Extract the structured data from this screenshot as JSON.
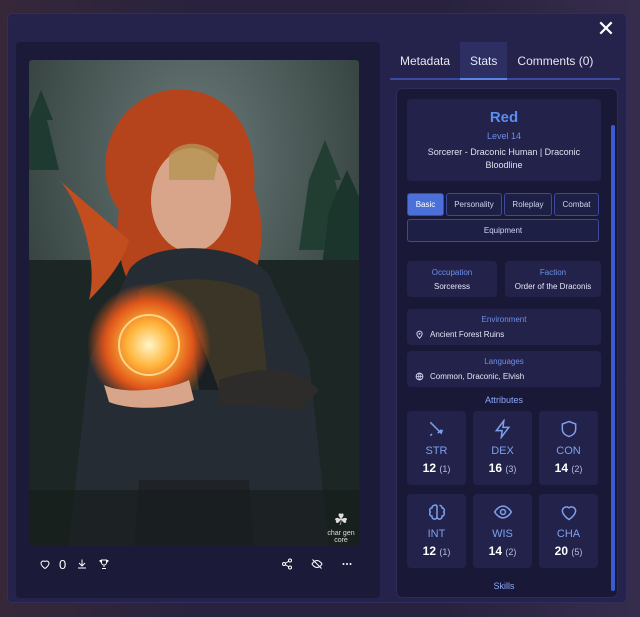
{
  "header": {
    "close_label": "✕"
  },
  "tabs": [
    {
      "label": "Metadata"
    },
    {
      "label": "Stats"
    },
    {
      "label": "Comments (0)"
    }
  ],
  "character": {
    "name": "Red",
    "level": "Level 14",
    "class_line": "Sorcerer - Draconic Human | Draconic Bloodline"
  },
  "subtabs": [
    {
      "label": "Basic"
    },
    {
      "label": "Personality"
    },
    {
      "label": "Roleplay"
    },
    {
      "label": "Combat"
    },
    {
      "label": "Equipment"
    }
  ],
  "info": {
    "occupation_label": "Occupation",
    "occupation_value": "Sorceress",
    "faction_label": "Faction",
    "faction_value": "Order of the Draconis",
    "environment_label": "Environment",
    "environment_value": "Ancient Forest Ruins",
    "languages_label": "Languages",
    "languages_value": "Common, Draconic, Elvish"
  },
  "attributes_title": "Attributes",
  "attributes": [
    {
      "name": "STR",
      "value": "12",
      "mod": "(1)",
      "icon": "sword-icon"
    },
    {
      "name": "DEX",
      "value": "16",
      "mod": "(3)",
      "icon": "lightning-icon"
    },
    {
      "name": "CON",
      "value": "14",
      "mod": "(2)",
      "icon": "shield-icon"
    },
    {
      "name": "INT",
      "value": "12",
      "mod": "(1)",
      "icon": "brain-icon"
    },
    {
      "name": "WIS",
      "value": "14",
      "mod": "(2)",
      "icon": "eye-icon"
    },
    {
      "name": "CHA",
      "value": "20",
      "mod": "(5)",
      "icon": "heart-icon"
    }
  ],
  "skills_title": "Skills",
  "toolbar": {
    "likes_count": "0"
  },
  "art": {
    "logo_text": "char gen core"
  },
  "colors": {
    "accent": "#5b8ef0",
    "panel": "#25234b",
    "card": "#23224a"
  }
}
